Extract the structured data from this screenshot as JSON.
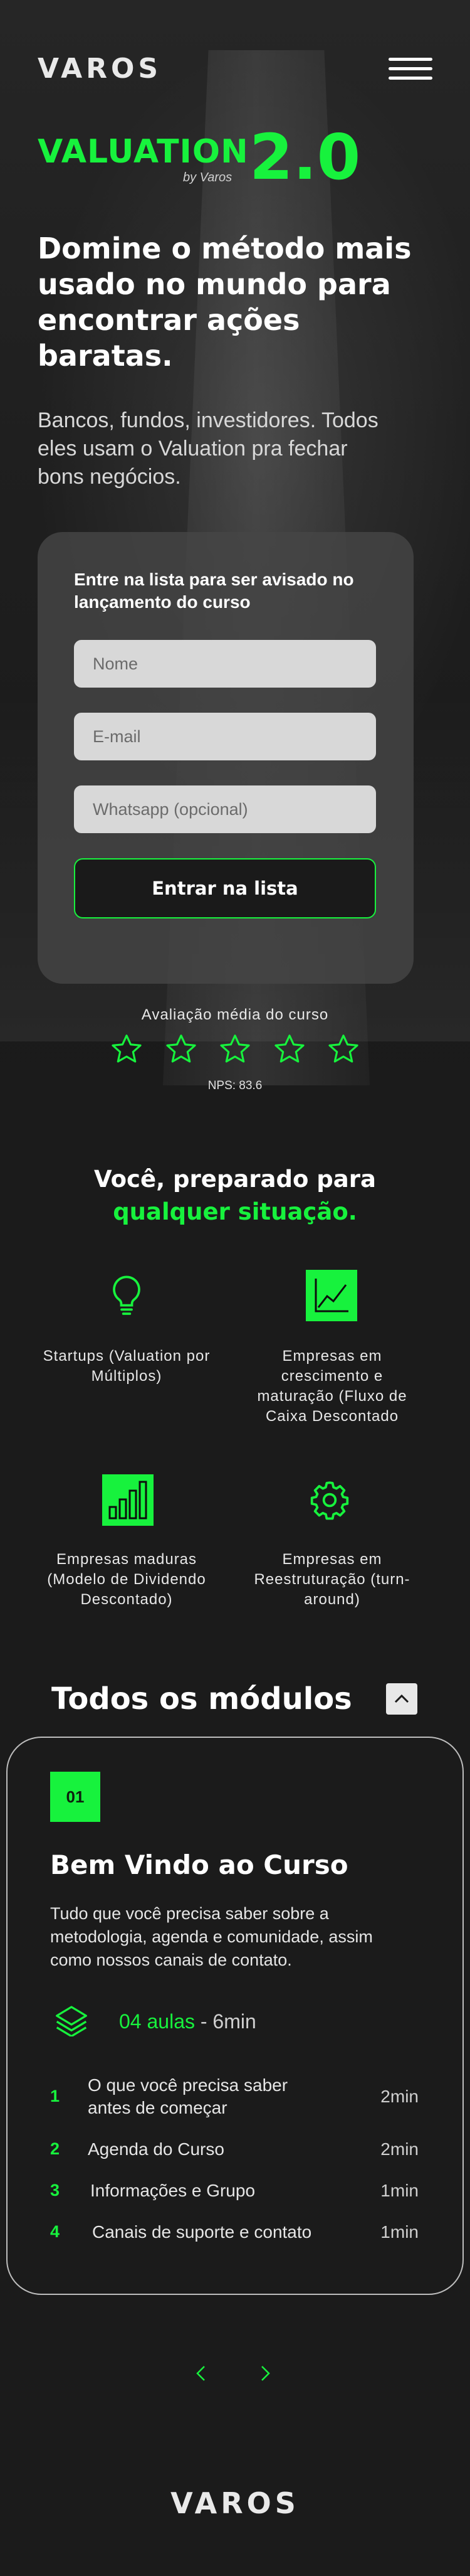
{
  "header": {
    "logo": "VAROS",
    "menu_icon": "hamburger-menu-icon"
  },
  "hero": {
    "product_title": "VALUATION",
    "product_by": "by Varos",
    "product_version": "2.0",
    "headline": "Domine o método mais usado no mundo para encontrar ações baratas.",
    "subheadline": "Bancos, fundos, investidores. Todos eles usam o Valuation pra fechar bons negócios."
  },
  "signup": {
    "title": "Entre na lista para ser avisado no lançamento do curso",
    "name_placeholder": "Nome",
    "email_placeholder": "E-mail",
    "whatsapp_placeholder": "Whatsapp (opcional)",
    "button_label": "Entrar na lista"
  },
  "rating": {
    "label": "Avaliação média do curso",
    "stars": 5,
    "nps": "NPS: 83.6"
  },
  "situations": {
    "title_line1": "Você, preparado para",
    "title_line2": "qualquer situação.",
    "items": [
      {
        "icon": "lightbulb-icon",
        "text": "Startups (Valuation por Múltiplos)"
      },
      {
        "icon": "growth-chart-icon",
        "text": "Empresas em crescimento e maturação (Fluxo de Caixa Descontado"
      },
      {
        "icon": "bar-chart-icon",
        "text": "Empresas maduras (Modelo de Dividendo Descontado)"
      },
      {
        "icon": "gear-icon",
        "text": "Empresas em Reestruturação (turn-around)"
      }
    ]
  },
  "modules": {
    "title": "Todos os módulos",
    "toggle_icon": "chevron-up-icon",
    "current": {
      "number": "01",
      "name": "Bem Vindo ao Curso",
      "description": "Tudo que você precisa saber sobre a metodologia, agenda e comunidade, assim como nossos canais de contato.",
      "lessons_count": "04 aulas",
      "separator": " - ",
      "duration": "6min",
      "lessons": [
        {
          "num": "1",
          "name": "O que você precisa saber antes de começar",
          "time": "2min"
        },
        {
          "num": "2",
          "name": "Agenda do Curso",
          "time": "2min"
        },
        {
          "num": "3",
          "name": "Informações e Grupo",
          "time": "1min"
        },
        {
          "num": "4",
          "name": "Canais de suporte e contato",
          "time": "1min"
        }
      ]
    },
    "prev_icon": "chevron-left-icon",
    "next_icon": "chevron-right-icon"
  },
  "footer": {
    "logo": "VAROS"
  },
  "colors": {
    "accent": "#17f23d",
    "background": "#1b1b1b",
    "card": "#464646"
  }
}
